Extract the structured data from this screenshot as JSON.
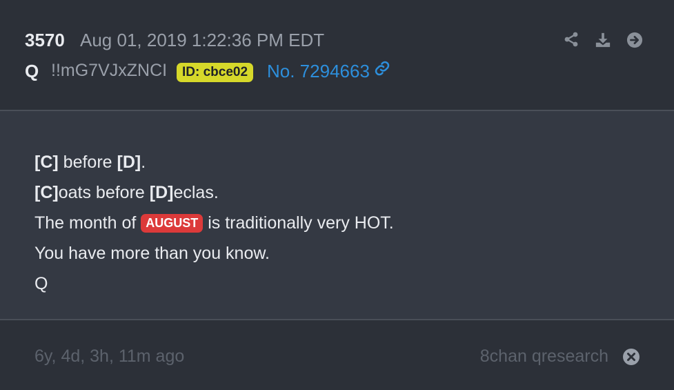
{
  "post": {
    "number": "3570",
    "date": "Aug 01, 2019 1:22:36 PM EDT",
    "author": "Q",
    "tripcode": "!!mG7VJxZNCI",
    "id_label": "ID: cbce02",
    "link_label": "No. 7294663"
  },
  "header_icons": [
    "share-icon",
    "download-icon",
    "arrow-right-circle-icon"
  ],
  "body": {
    "line1_a": "[C]",
    "line1_b": " before ",
    "line1_c": "[D]",
    "line1_d": ".",
    "line2_a": "[C]",
    "line2_b": "oats before ",
    "line2_c": "[D]",
    "line2_d": "eclas.",
    "line3_a": "The month of ",
    "line3_badge": "AUGUST",
    "line3_b": " is traditionally very HOT.",
    "line4": "You have more than you know.",
    "line5": "Q"
  },
  "footer": {
    "ago": "6y, 4d, 3h, 11m ago",
    "source": "8chan qresearch"
  },
  "colors": {
    "background": "#2c3038",
    "panel": "#343943",
    "id_badge": "#d6d82a",
    "link": "#2d8fdc",
    "highlight_badge": "#dc3a3a"
  }
}
